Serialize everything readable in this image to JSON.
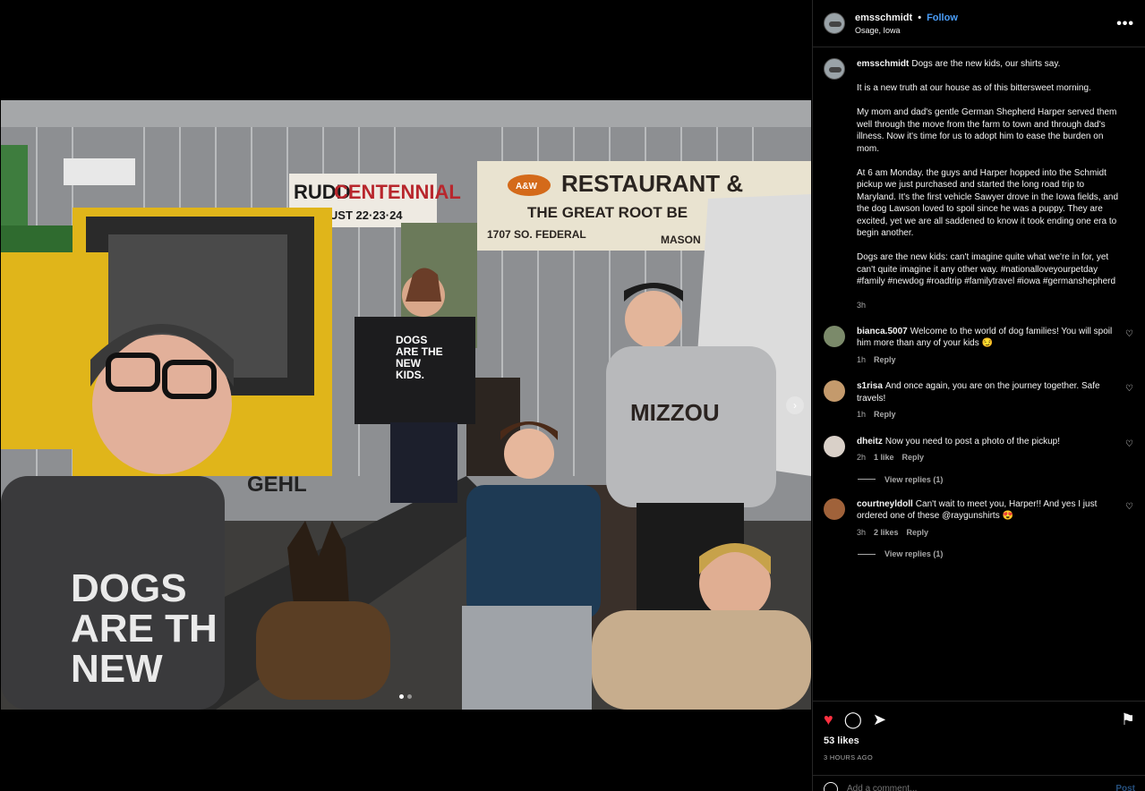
{
  "post": {
    "username": "emsschmidt",
    "dot": "•",
    "follow_label": "Follow",
    "location": "Osage, Iowa",
    "more_icon": "•••"
  },
  "caption": {
    "username": "emsschmidt",
    "paragraphs": [
      "Dogs are the new kids, our shirts say.",
      "It is a new truth at our house as of this bittersweet morning.",
      "My mom and dad's gentle German Shepherd Harper served them well through the move from the farm to town and through dad's illness. Now it's time for us to adopt him to ease the burden on mom.",
      "At 6 am Monday. the guys and Harper hopped into the Schmidt pickup we just purchased and started the long road trip to Maryland. It's the first vehicle Sawyer drove in the Iowa fields, and the dog Lawson loved to spoil since he was a puppy. They are excited, yet we are all saddened to know it took ending one era to begin another.",
      "Dogs are the new kids: can't imagine quite what we're in for, yet can't quite imagine it any other way. #nationalloveyourpetday #family #newdog #roadtrip #familytravel #iowa #germanshepherd"
    ],
    "time": "3h"
  },
  "comments": [
    {
      "username": "bianca.5007",
      "text": "Welcome to the world of dog families! You will spoil him more than any of your kids 😏",
      "time": "1h",
      "likes": "",
      "reply_label": "Reply",
      "view_replies": "",
      "avatar_color": "#7b8a6a"
    },
    {
      "username": "s1risa",
      "text": "And once again, you are on the journey together. Safe travels!",
      "time": "1h",
      "likes": "",
      "reply_label": "Reply",
      "view_replies": "",
      "avatar_color": "#c49a6c"
    },
    {
      "username": "dheitz",
      "text": "Now you need to post a photo of the pickup!",
      "time": "2h",
      "likes": "1 like",
      "reply_label": "Reply",
      "view_replies": "View replies (1)",
      "avatar_color": "#d9d0c8"
    },
    {
      "username": "courtneyldoll",
      "text": "Can't wait to meet you, Harper!! And yes I just ordered one of these @raygunshirts 😍",
      "time": "3h",
      "likes": "2 likes",
      "reply_label": "Reply",
      "view_replies": "View replies (1)",
      "avatar_color": "#a0623a"
    }
  ],
  "icons": {
    "like": "♥",
    "comment": "◯",
    "share": "➤",
    "save": "⚑",
    "comment_like": "♡",
    "next": "›"
  },
  "engagement": {
    "likes": "53 likes",
    "time_ago": "3 HOURS AGO"
  },
  "add_comment": {
    "placeholder": "Add a comment...",
    "post_label": "Post"
  },
  "photo_signs": {
    "rudd_line1": "RUDD",
    "rudd_line2": "CENTENNIAL",
    "rudd_dates": "AUGUST 22·23·24",
    "aw_logo": "A&W",
    "restaurant": "RESTAURANT &",
    "root_beer": "THE GREAT ROOT BE",
    "address": "1707 SO. FEDERAL",
    "mason": "MASON",
    "gehl": "GEHL",
    "shirt_small": [
      "DOGS",
      "ARE THE",
      "NEW",
      "KIDS."
    ],
    "shirt_big": [
      "DOGS",
      "ARE TH",
      "NEW"
    ],
    "mizzou": "MIZZOU"
  },
  "colors": {
    "accent": "#4a9df8",
    "like_red": "#ff3040",
    "gehl_yellow": "#f0c419"
  }
}
